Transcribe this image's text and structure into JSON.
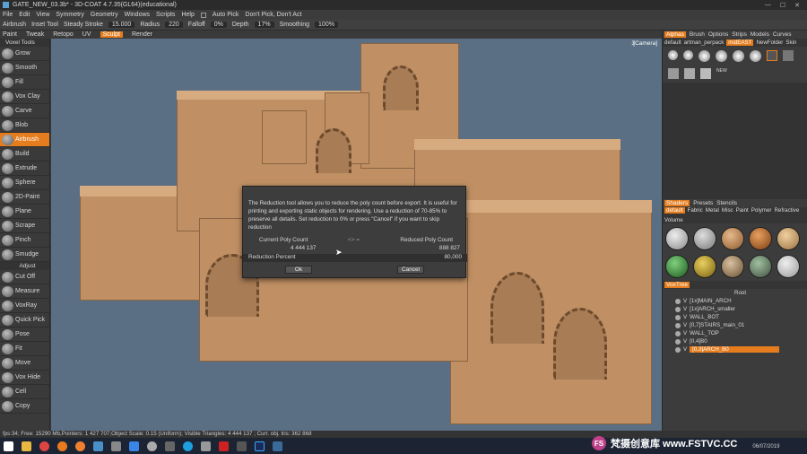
{
  "titlebar": {
    "title": "GATE_NEW_03.3b* - 3D-COAT 4.7.35(GL64)(educational)"
  },
  "menu": [
    "File",
    "Edit",
    "View",
    "Symmetry",
    "Geometry",
    "Windows",
    "Scripts",
    "Help"
  ],
  "toolbar": {
    "autopick": "Auto Pick",
    "dontpick": "Don't Pick, Don't Act",
    "tool": "Airbrush",
    "inset": "Inset Tool",
    "steady": "Steady Stroke",
    "steady_val": "15.000",
    "radius": "Radius",
    "radius_val": "220",
    "falloff": "Falloff",
    "falloff_val": "0%",
    "depth": "Depth",
    "depth_val": "17%",
    "smoothing": "Smoothing",
    "smoothing_val": "100%"
  },
  "tabs": [
    {
      "label": "Paint"
    },
    {
      "label": "Tweak"
    },
    {
      "label": "Retopo"
    },
    {
      "label": "UV"
    },
    {
      "label": "Sculpt",
      "active": true
    },
    {
      "label": "Render"
    }
  ],
  "tools": {
    "header": "Voxel Tools",
    "adjust": "Adjust",
    "items": [
      "Grow",
      "Smooth",
      "Fill",
      "Vox Clay",
      "Carve",
      "Blob",
      "Airbrush",
      "Build",
      "Extrude",
      "Sphere",
      "2D-Paint",
      "Plane",
      "Scrape",
      "Pinch",
      "Smudge"
    ],
    "selected": "Airbrush",
    "adjust_items": [
      "Cut Off",
      "Measure",
      "VoxRay",
      "Quick Pick",
      "Pose",
      "Fit",
      "Move",
      "Vox Hide",
      "Cell",
      "Copy"
    ]
  },
  "viewport": {
    "camera": "[Camera]",
    "count": "3"
  },
  "dialog": {
    "text": "The Reduction tool allows you to reduce the poly count before export. It is useful for printing and exporting static objects for rendering. Use a reduction of 70-85% to preserve all details. Set reduction to 0% or press \"Cancel\" if you want to skip reduction",
    "current_label": "Current Poly Count",
    "arrow": "<> =",
    "reduced_label": "Reduced Poly Count",
    "current_val": "4 444 137",
    "reduced_val": "888 827",
    "percent_label": "Reduction Percent",
    "percent_val": "80,000",
    "ok": "Ok",
    "cancel": "Cancel"
  },
  "right": {
    "tabs": [
      "Alphas",
      "Brush",
      "Options",
      "Strips",
      "Models",
      "Curves"
    ],
    "alpha_sub": [
      "default",
      "artman_perpack",
      "midEAST",
      "NewFolder",
      "Skin"
    ],
    "new_label": "NEW",
    "shader_tabs": [
      "Shaders",
      "Presets",
      "Stencils"
    ],
    "shader_sub": [
      "default",
      "Fabric",
      "Metal",
      "Misc",
      "Paint",
      "Polymer",
      "Refractive",
      "Volume"
    ],
    "voxtree": "VoxTree",
    "root": "Root",
    "tree": [
      {
        "label": "[1x]MAIN_ARCH"
      },
      {
        "label": "[1x]ARCH_smaller"
      },
      {
        "label": "WALL_BOT"
      },
      {
        "label": "[0,7]STAIRS_main_01"
      },
      {
        "label": "WALL_TOP"
      },
      {
        "label": "[0,4]B0"
      },
      {
        "label": "[0,3]ARCH_B0",
        "selected": true
      }
    ]
  },
  "status": "fps:34;   Free: 15290 Mb,Pointers: 1 427 707;Object Scale: 0.15 (Uniform); Visible Triangles: 4 444 137 ; Curr. obj. tris: 362 868",
  "watermark": {
    "logo": "FS",
    "text": "梵摄创意库 www.FSTVC.CC",
    "date": "06/07/2019"
  },
  "colors": {
    "accent": "#e57d1f",
    "viewport_bg": "#5a6f84",
    "clay": "#c09064"
  }
}
